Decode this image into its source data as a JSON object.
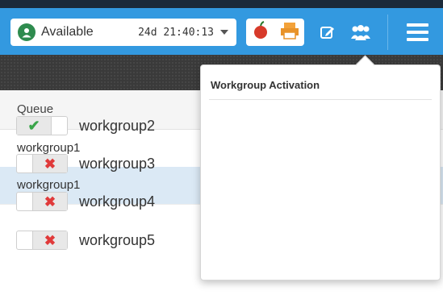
{
  "header": {
    "status_label": "Available",
    "status_timer": "24d 21:40:13",
    "colors": {
      "bar": "#3399e0",
      "status_online": "#2e8b4e"
    },
    "icons": [
      "apple-icon",
      "printer-icon",
      "edit-icon",
      "users-icon",
      "hamburger-menu-icon"
    ]
  },
  "queue": {
    "column_header": "Queue",
    "rows": [
      {
        "name": "workgroup1",
        "selected": false
      },
      {
        "name": "workgroup1",
        "selected": true
      }
    ]
  },
  "popover": {
    "title": "Workgroup Activation",
    "items": [
      {
        "label": "workgroup2",
        "active": true
      },
      {
        "label": "workgroup3",
        "active": false
      },
      {
        "label": "workgroup4",
        "active": false
      },
      {
        "label": "workgroup5",
        "active": false
      }
    ]
  }
}
